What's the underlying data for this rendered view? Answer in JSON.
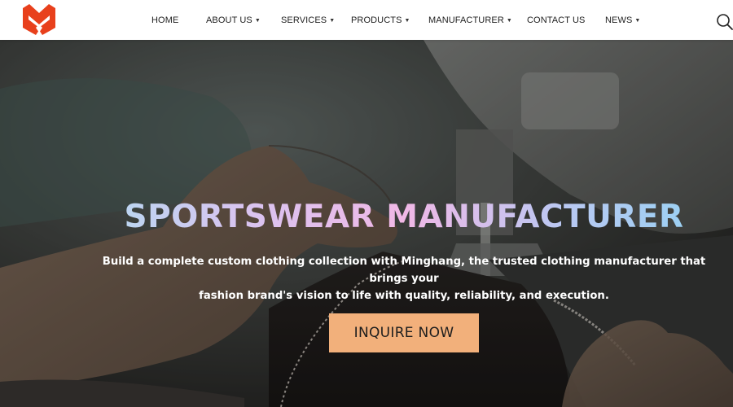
{
  "brand": {
    "logo_icon": "minghang-m-logo-icon",
    "logo_color": "#e8401c"
  },
  "nav": {
    "items": [
      {
        "label": "HOME",
        "has_dropdown": false
      },
      {
        "label": "ABOUT US",
        "has_dropdown": true
      },
      {
        "label": "SERVICES",
        "has_dropdown": true
      },
      {
        "label": "PRODUCTS",
        "has_dropdown": true
      },
      {
        "label": "MANUFACTURER",
        "has_dropdown": true
      },
      {
        "label": "CONTACT US",
        "has_dropdown": false
      },
      {
        "label": "NEWS",
        "has_dropdown": true
      }
    ],
    "dropdown_icon": "caret-down-icon",
    "search_icon": "search-icon"
  },
  "hero": {
    "title": "SPORTSWEAR MANUFACTURER",
    "subtitle_line1": "Build a complete custom clothing collection with Minghang, the trusted clothing manufacturer that brings your",
    "subtitle_line2": "fashion brand's vision to life with quality, reliability, and execution.",
    "cta_label": "INQUIRE NOW",
    "cta_color": "#f2b07b",
    "background_image": "sewing-machine-hands-photo"
  }
}
